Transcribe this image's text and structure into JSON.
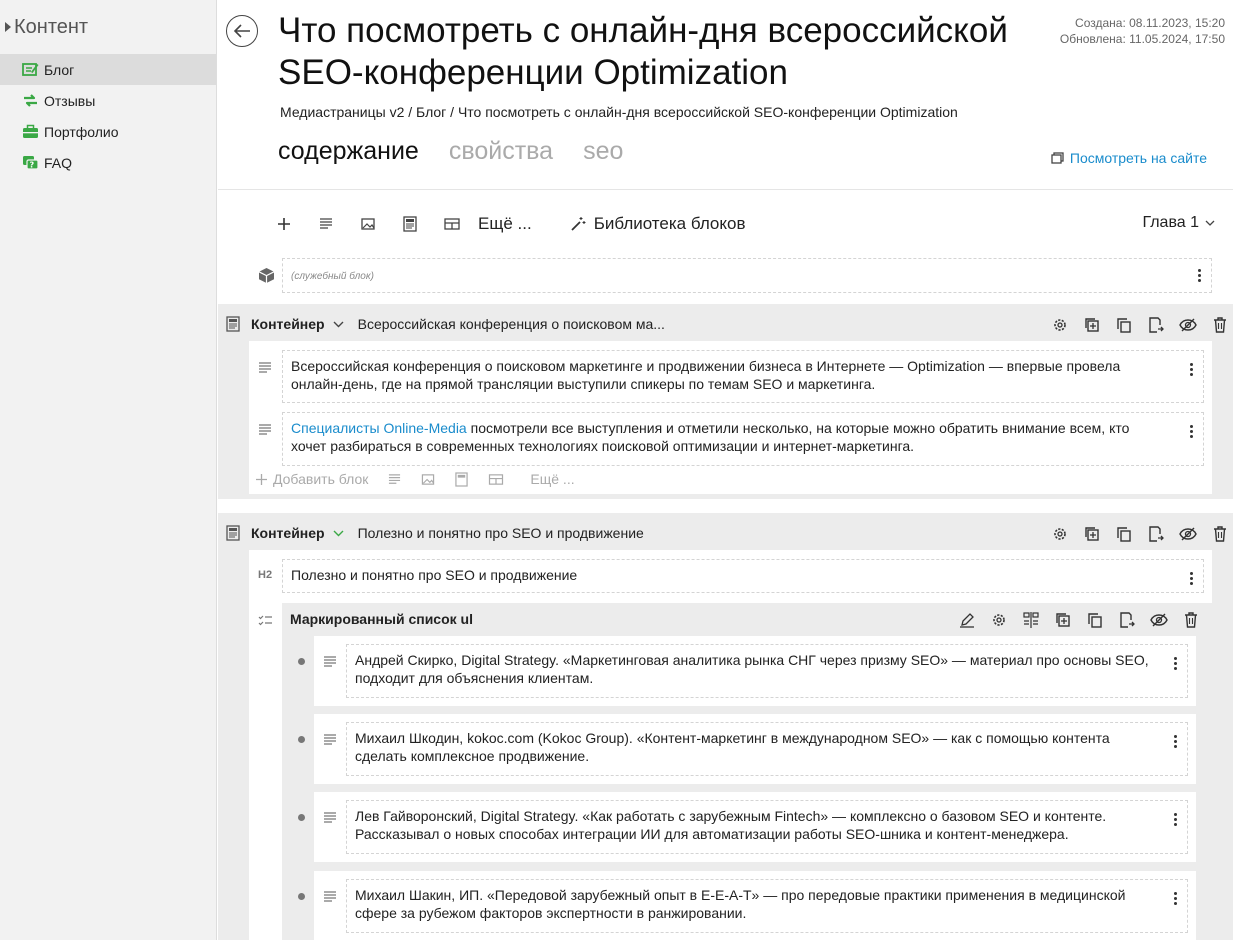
{
  "sidebar": {
    "title": "Контент",
    "items": [
      {
        "label": "Блог",
        "icon": "blog-icon",
        "active": true
      },
      {
        "label": "Отзывы",
        "icon": "reviews-icon",
        "active": false
      },
      {
        "label": "Портфолио",
        "icon": "portfolio-icon",
        "active": false
      },
      {
        "label": "FAQ",
        "icon": "faq-icon",
        "active": false
      }
    ]
  },
  "header": {
    "title": "Что посмотреть с онлайн-дня всероссийской SEO-конференции Optimization",
    "created": "Создана: 08.11.2023, 15:20",
    "updated": "Обновлена: 11.05.2024, 17:50",
    "breadcrumb": "Медиастраницы v2 / Блог / Что посмотреть с онлайн-дня всероссийской SEO-конференции Optimization",
    "tabs": [
      {
        "label": "содержание",
        "active": true
      },
      {
        "label": "свойства",
        "active": false
      },
      {
        "label": "seo",
        "active": false
      }
    ],
    "view_site": "Посмотреть на сайте"
  },
  "toolbar": {
    "more": "Ещё ...",
    "library": "Библиотека блоков",
    "chapter": "Глава 1"
  },
  "service_block": {
    "label": "(служебный блок)"
  },
  "containers": [
    {
      "type_label": "Контейнер",
      "name": "Всероссийская конференция о поисковом ма...",
      "blocks": [
        {
          "text": "Всероссийская конференция о поисковом маркетинге и продвижении бизнеса в Интернете — Optimization — впервые провела онлайн-день, где на прямой трансляции выступили спикеры по темам SEO и маркетинга."
        },
        {
          "link": "Специалисты Online-Media",
          "text": " посмотрели все выступления и отметили несколько, на которые можно обратить внимание всем, кто хочет разбираться в современных технологиях поисковой оптимизации и интернет-маркетинга."
        }
      ],
      "add_block": "Добавить блок",
      "add_more": "Ещё ..."
    },
    {
      "type_label": "Контейнер",
      "name": "Полезно и понятно про SEO и продвижение",
      "heading_tag": "H2",
      "heading": "Полезно и понятно про SEO и продвижение",
      "list_title": "Маркированный список ul",
      "list_items": [
        "Андрей Скирко, Digital Strategy. «Маркетинговая аналитика рынка СНГ через призму SEO» — материал про основы SEO, подходит для объяснения клиентам.",
        "Михаил Шкодин, kokoc.com (Kokoc Group). «Контент-маркетинг в международном SEO» — как с помощью контента сделать комплексное продвижение.",
        "Лев Гайворонский, Digital Strategy. «Как работать с зарубежным Fintech» — комплексно о базовом SEO и контенте. Рассказывал о новых способах интеграции ИИ для автоматизации работы SEO-шника и контент-менеджера.",
        "Михаил Шакин, ИП. «Передовой зарубежный опыт в E-E-A-T» — про передовые практики применения в медицинской сфере за рубежом факторов экспертности в ранжировании."
      ]
    }
  ],
  "colors": {
    "accent": "#1a8ccc",
    "sidebar_icon": "#3aa845",
    "active_bg": "#dcdcdc",
    "container_bg": "#ececec"
  }
}
